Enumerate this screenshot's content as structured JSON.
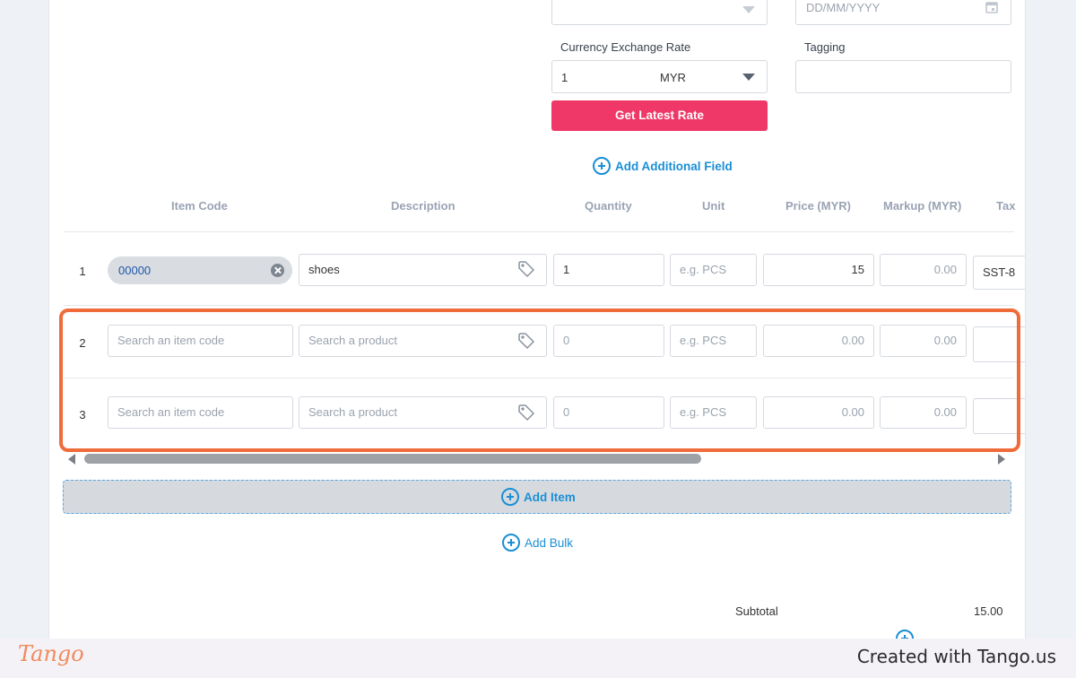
{
  "header_fields": {
    "date_placeholder": "DD/MM/YYYY",
    "currency_label": "Currency Exchange Rate",
    "currency_value": "1",
    "currency_code": "MYR",
    "tagging_label": "Tagging",
    "get_rate_button": "Get Latest Rate",
    "add_field_link": "Add Additional Field"
  },
  "table": {
    "columns": [
      "Item Code",
      "Description",
      "Quantity",
      "Unit",
      "Price (MYR)",
      "Markup (MYR)",
      "Tax"
    ],
    "rows": [
      {
        "num": "1",
        "item_code": "00000",
        "description": "shoes",
        "quantity": "1",
        "unit_placeholder": "e.g. PCS",
        "price": "15",
        "markup": "0.00",
        "tax": "SST-8"
      },
      {
        "num": "2",
        "item_code_placeholder": "Search an item code",
        "description_placeholder": "Search a product",
        "quantity": "0",
        "unit_placeholder": "e.g. PCS",
        "price": "0.00",
        "markup": "0.00"
      },
      {
        "num": "3",
        "item_code_placeholder": "Search an item code",
        "description_placeholder": "Search a product",
        "quantity": "0",
        "unit_placeholder": "e.g. PCS",
        "price": "0.00",
        "markup": "0.00"
      }
    ]
  },
  "actions": {
    "add_item": "Add Item",
    "add_bulk": "Add Bulk"
  },
  "totals": {
    "subtotal_label": "Subtotal",
    "subtotal_value": "15.00"
  },
  "footer": {
    "logo": "Tango",
    "created_with": "Created with Tango.us"
  },
  "colors": {
    "accent_pink": "#ef3867",
    "link_blue": "#1a8fd6",
    "highlight_orange": "#f06b3a"
  }
}
